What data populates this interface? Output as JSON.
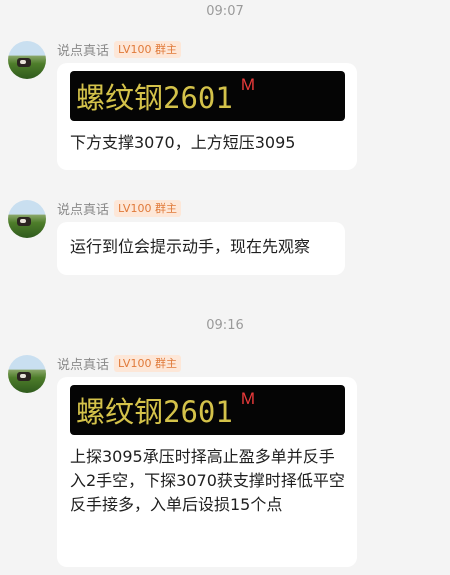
{
  "timestamps": [
    "09:07",
    "09:16"
  ],
  "messages": [
    {
      "sender": "说点真话",
      "badge": "LV100 群主",
      "ticker": {
        "name": "螺纹钢2601",
        "flag": "M"
      },
      "text": "下方支撑3070，上方短压3095"
    },
    {
      "sender": "说点真话",
      "badge": "LV100 群主",
      "text": "运行到位会提示动手，现在先观察"
    },
    {
      "sender": "说点真话",
      "badge": "LV100 群主",
      "ticker": {
        "name": "螺纹钢2601",
        "flag": "M"
      },
      "text": "上探3095承压时择高止盈多单并反手入2手空，下探3070获支撑时择低平空反手接多，入单后设损15个点"
    }
  ],
  "colors": {
    "background": "#f4f4f4",
    "bubble": "#ffffff",
    "badge_text": "#e07a3a",
    "badge_bg": "#fde7d8",
    "ticker_text": "#d4c24a",
    "ticker_flag": "#e83a3a"
  }
}
